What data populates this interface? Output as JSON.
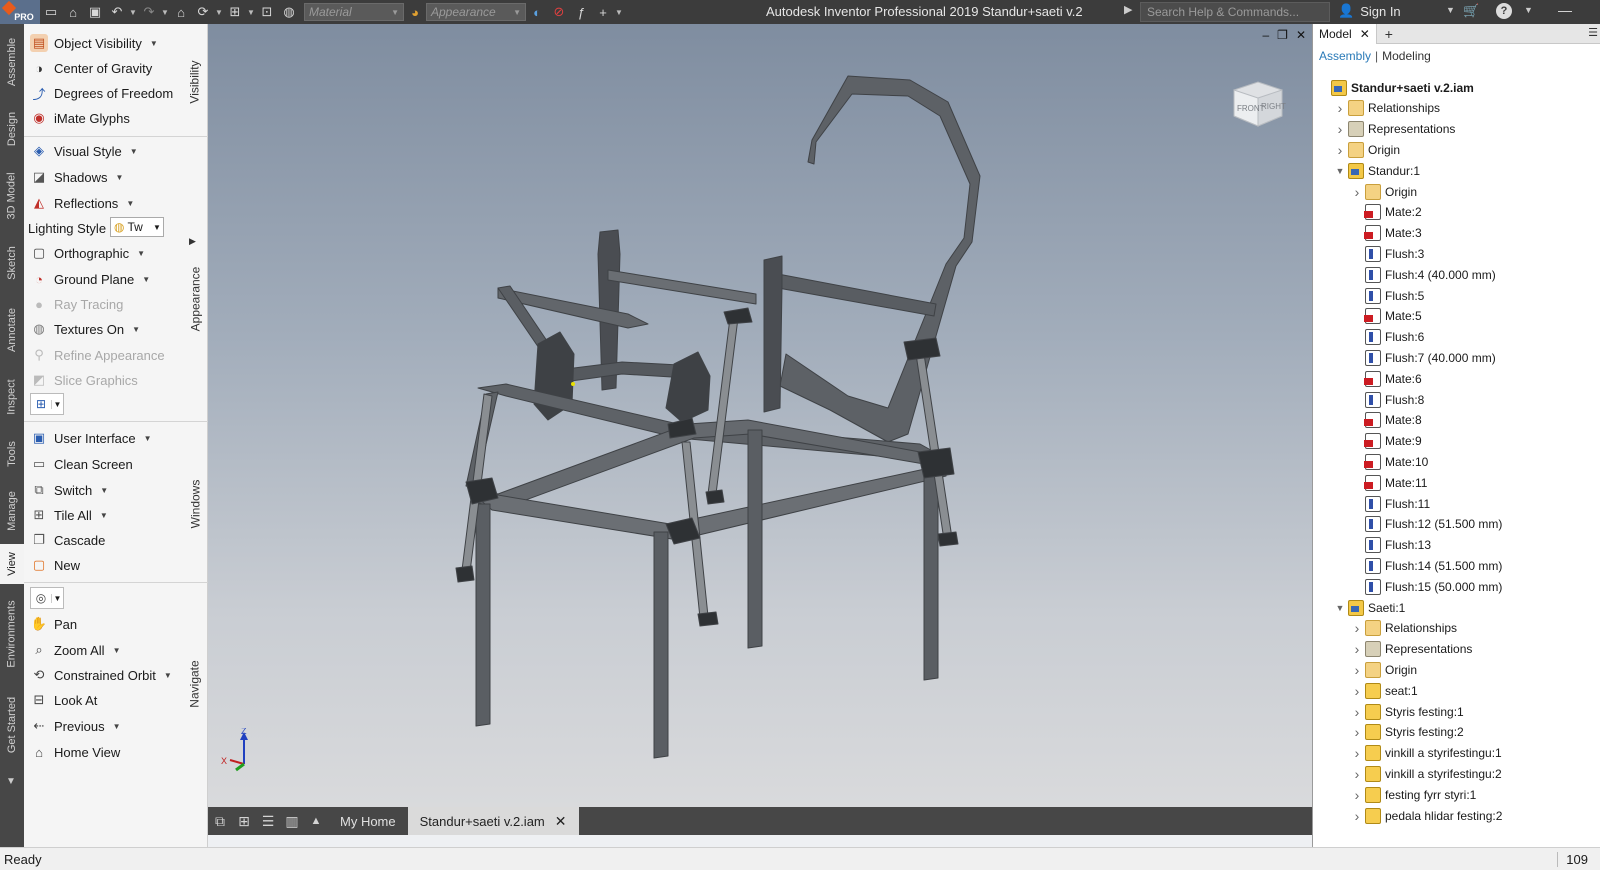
{
  "title_bar": {
    "logo_text": "PRO",
    "material_placeholder": "Material",
    "appearance_placeholder": "Appearance",
    "title": "Autodesk Inventor Professional 2019    Standur+saeti v.2",
    "search_placeholder": "Search Help & Commands...",
    "sign_in": "Sign In"
  },
  "left_tabs": [
    "Assemble",
    "Design",
    "3D Model",
    "Sketch",
    "Annotate",
    "Inspect",
    "Tools",
    "Manage",
    "View",
    "Environments",
    "Get Started"
  ],
  "active_left_tab": "View",
  "ribbon": {
    "visibility_label": "Visibility",
    "appearance_label": "Appearance",
    "windows_label": "Windows",
    "navigate_label": "Navigate",
    "object_visibility": "Object Visibility",
    "center_of_gravity": "Center of Gravity",
    "degrees_of_freedom": "Degrees of Freedom",
    "imate_glyphs": "iMate Glyphs",
    "visual_style": "Visual Style",
    "shadows": "Shadows",
    "reflections": "Reflections",
    "lighting_style": "Lighting Style",
    "lighting_value": "Tw",
    "orthographic": "Orthographic",
    "ground_plane": "Ground Plane",
    "ray_tracing": "Ray Tracing",
    "textures_on": "Textures On",
    "refine_appearance": "Refine Appearance",
    "slice_graphics": "Slice Graphics",
    "user_interface": "User Interface",
    "clean_screen": "Clean Screen",
    "switch": "Switch",
    "tile_all": "Tile All",
    "cascade": "Cascade",
    "new": "New",
    "pan": "Pan",
    "zoom_all": "Zoom All",
    "constrained_orbit": "Constrained Orbit",
    "look_at": "Look At",
    "previous": "Previous",
    "home_view": "Home View"
  },
  "viewport": {
    "viewcube_front": "FRONT",
    "viewcube_right": "RIGHT",
    "axis_z": "Z",
    "axis_x": "X"
  },
  "doc_tabs": {
    "my_home": "My Home",
    "active_doc": "Standur+saeti v.2.iam"
  },
  "browser": {
    "tab": "Model",
    "mode_assembly": "Assembly",
    "mode_modeling": "Modeling",
    "tree": [
      {
        "label": "Standur+saeti v.2.iam",
        "icon": "asm",
        "level": 0,
        "expand": "",
        "root": true
      },
      {
        "label": "Relationships",
        "icon": "folder",
        "level": 1,
        "expand": ">"
      },
      {
        "label": "Representations",
        "icon": "repr",
        "level": 1,
        "expand": ">"
      },
      {
        "label": "Origin",
        "icon": "folder",
        "level": 1,
        "expand": ">"
      },
      {
        "label": "Standur:1",
        "icon": "asm",
        "level": 1,
        "expand": "v"
      },
      {
        "label": "Origin",
        "icon": "folder",
        "level": 2,
        "expand": ">"
      },
      {
        "label": "Mate:2",
        "icon": "mate",
        "level": 2,
        "expand": ""
      },
      {
        "label": "Mate:3",
        "icon": "mate",
        "level": 2,
        "expand": ""
      },
      {
        "label": "Flush:3",
        "icon": "flush",
        "level": 2,
        "expand": ""
      },
      {
        "label": "Flush:4 (40.000 mm)",
        "icon": "flush",
        "level": 2,
        "expand": ""
      },
      {
        "label": "Flush:5",
        "icon": "flush",
        "level": 2,
        "expand": ""
      },
      {
        "label": "Mate:5",
        "icon": "mate",
        "level": 2,
        "expand": ""
      },
      {
        "label": "Flush:6",
        "icon": "flush",
        "level": 2,
        "expand": ""
      },
      {
        "label": "Flush:7 (40.000 mm)",
        "icon": "flush",
        "level": 2,
        "expand": ""
      },
      {
        "label": "Mate:6",
        "icon": "mate",
        "level": 2,
        "expand": ""
      },
      {
        "label": "Flush:8",
        "icon": "flush",
        "level": 2,
        "expand": ""
      },
      {
        "label": "Mate:8",
        "icon": "mate",
        "level": 2,
        "expand": ""
      },
      {
        "label": "Mate:9",
        "icon": "mate",
        "level": 2,
        "expand": ""
      },
      {
        "label": "Mate:10",
        "icon": "mate",
        "level": 2,
        "expand": ""
      },
      {
        "label": "Mate:11",
        "icon": "mate",
        "level": 2,
        "expand": ""
      },
      {
        "label": "Flush:11",
        "icon": "flush",
        "level": 2,
        "expand": ""
      },
      {
        "label": "Flush:12 (51.500 mm)",
        "icon": "flush",
        "level": 2,
        "expand": ""
      },
      {
        "label": "Flush:13",
        "icon": "flush",
        "level": 2,
        "expand": ""
      },
      {
        "label": "Flush:14 (51.500 mm)",
        "icon": "flush",
        "level": 2,
        "expand": ""
      },
      {
        "label": "Flush:15 (50.000 mm)",
        "icon": "flush",
        "level": 2,
        "expand": ""
      },
      {
        "label": "Saeti:1",
        "icon": "asm",
        "level": 1,
        "expand": "v"
      },
      {
        "label": "Relationships",
        "icon": "folder",
        "level": 2,
        "expand": ">"
      },
      {
        "label": "Representations",
        "icon": "repr",
        "level": 2,
        "expand": ">"
      },
      {
        "label": "Origin",
        "icon": "folder",
        "level": 2,
        "expand": ">"
      },
      {
        "label": "seat:1",
        "icon": "part",
        "level": 2,
        "expand": ">"
      },
      {
        "label": "Styris festing:1",
        "icon": "part",
        "level": 2,
        "expand": ">"
      },
      {
        "label": "Styris festing:2",
        "icon": "part",
        "level": 2,
        "expand": ">"
      },
      {
        "label": "vinkill a styrifestingu:1",
        "icon": "part",
        "level": 2,
        "expand": ">"
      },
      {
        "label": "vinkill a styrifestingu:2",
        "icon": "part",
        "level": 2,
        "expand": ">"
      },
      {
        "label": "festing fyrr styri:1",
        "icon": "part",
        "level": 2,
        "expand": ">"
      },
      {
        "label": "pedala hlidar festing:2",
        "icon": "part",
        "level": 2,
        "expand": ">"
      }
    ]
  },
  "status": {
    "left": "Ready",
    "right_count": "109"
  }
}
